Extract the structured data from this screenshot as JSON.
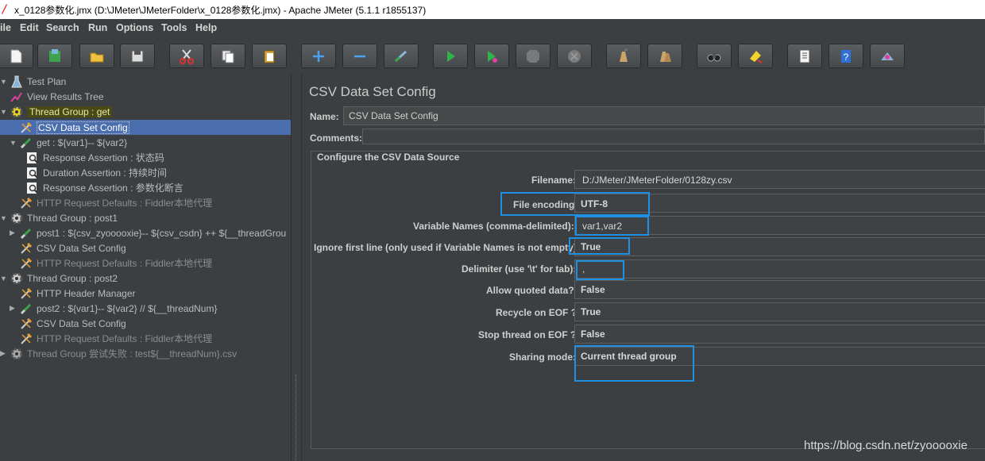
{
  "window": {
    "title": "x_0128参数化.jmx (D:\\JMeter\\JMeterFolder\\x_0128参数化.jmx) - Apache JMeter (5.1.1 r1855137)"
  },
  "menu": {
    "items": [
      "ile",
      "Edit",
      "Search",
      "Run",
      "Options",
      "Tools",
      "Help"
    ]
  },
  "toolbar": {
    "buttons": [
      "new-icon",
      "templates-icon",
      "open-icon",
      "save-icon",
      "cut-icon",
      "copy-icon",
      "paste-icon",
      "expand-icon",
      "collapse-icon",
      "toggle-icon",
      "start-icon",
      "start-no-pauses-icon",
      "stop-icon",
      "shutdown-icon",
      "clear-icon",
      "clear-all-icon",
      "search-icon",
      "reset-search-icon",
      "function-helper-icon",
      "help-icon",
      "remote-icon"
    ]
  },
  "tree": {
    "nodes": [
      {
        "label": "Test Plan",
        "icon": "test-plan-icon"
      },
      {
        "label": "View Results Tree",
        "icon": "listener-icon"
      },
      {
        "label": "Thread Group : get",
        "icon": "thread-group-icon"
      },
      {
        "label": "CSV Data Set Config",
        "icon": "config-icon"
      },
      {
        "label": "get : ${var1}-- ${var2}",
        "icon": "sampler-icon"
      },
      {
        "label": "Response Assertion : 状态码",
        "icon": "assertion-icon"
      },
      {
        "label": "Duration Assertion : 持续时间",
        "icon": "assertion-icon"
      },
      {
        "label": "Response Assertion : 参数化断言",
        "icon": "assertion-icon"
      },
      {
        "label": "HTTP Request Defaults : Fiddler本地代理",
        "icon": "config-icon"
      },
      {
        "label": "Thread Group : post1",
        "icon": "thread-group-icon"
      },
      {
        "label": "post1 : ${csv_zyooooxie}-- ${csv_csdn} ++ ${__threadGrou",
        "icon": "sampler-icon"
      },
      {
        "label": "CSV Data Set Config",
        "icon": "config-icon"
      },
      {
        "label": "HTTP Request Defaults : Fiddler本地代理",
        "icon": "config-icon"
      },
      {
        "label": "Thread Group : post2",
        "icon": "thread-group-icon"
      },
      {
        "label": "HTTP Header Manager",
        "icon": "config-icon"
      },
      {
        "label": "post2 : ${var1}-- ${var2} // ${__threadNum}",
        "icon": "sampler-icon"
      },
      {
        "label": "CSV Data Set Config",
        "icon": "config-icon"
      },
      {
        "label": "HTTP Request Defaults : Fiddler本地代理",
        "icon": "config-icon"
      },
      {
        "label": "Thread Group 尝试失败 : test${__threadNum}.csv",
        "icon": "thread-group-icon"
      }
    ]
  },
  "panel": {
    "title": "CSV Data Set Config",
    "name_label": "Name:",
    "name_value": "CSV Data Set Config",
    "comments_label": "Comments:",
    "group_title": "Configure the CSV Data Source",
    "fields": [
      {
        "label": "Filename:",
        "value": "D:/JMeter/JMeterFolder/0128zy.csv"
      },
      {
        "label": "File encoding:",
        "value": "UTF-8"
      },
      {
        "label": "Variable Names (comma-delimited):",
        "value": "var1,var2"
      },
      {
        "label": "Ignore first line (only used if Variable Names is not empty):",
        "value": "True"
      },
      {
        "label": "Delimiter (use '\\t' for tab):",
        "value": ","
      },
      {
        "label": "Allow quoted data?:",
        "value": "False"
      },
      {
        "label": "Recycle on EOF ?:",
        "value": "True"
      },
      {
        "label": "Stop thread on EOF ?:",
        "value": "False"
      },
      {
        "label": "Sharing mode:",
        "value": "Current thread group"
      }
    ]
  },
  "watermark": "https://blog.csdn.net/zyooooxie",
  "colors": {
    "background": "#3c3f41",
    "selection": "#4b6eaf",
    "highlight_box": "#1e8fe1",
    "thread_group_highlight": "#4a4a18"
  }
}
